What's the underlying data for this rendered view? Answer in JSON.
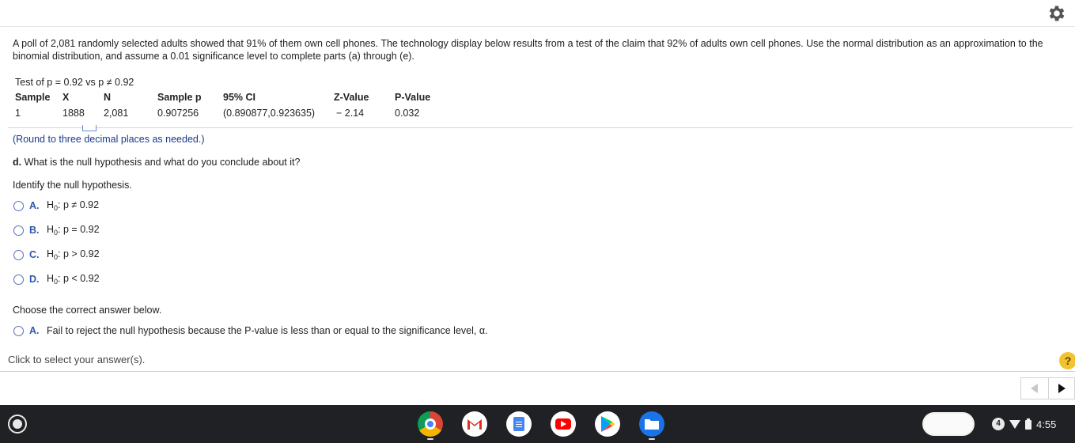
{
  "problem_text": "A poll of 2,081 randomly selected adults showed that 91% of them own cell phones. The technology display below results from a test of the claim that 92% of adults own cell phones. Use the normal distribution as an approximation to the binomial distribution, and assume a 0.01 significance level to complete parts (a) through (e).",
  "tech_display": {
    "test_line": "Test of p = 0.92 vs p ≠ 0.92",
    "headers": [
      "Sample",
      "X",
      "N",
      "Sample p",
      "95% CI",
      "Z-Value",
      "P-Value"
    ],
    "row": [
      "1",
      "1888",
      "2,081",
      "0.907256",
      "(0.890877,0.923635)",
      "− 2.14",
      "0.032"
    ]
  },
  "round_note": "(Round to three decimal places as needed.)",
  "part_d": {
    "label": "d.",
    "question": "What is the null hypothesis and what do you conclude about it?",
    "identify": "Identify the null hypothesis.",
    "options": [
      {
        "letter": "A.",
        "h": "H",
        "sub": "0",
        "text": ": p ≠ 0.92"
      },
      {
        "letter": "B.",
        "h": "H",
        "sub": "0",
        "text": ": p = 0.92"
      },
      {
        "letter": "C.",
        "h": "H",
        "sub": "0",
        "text": ": p > 0.92"
      },
      {
        "letter": "D.",
        "h": "H",
        "sub": "0",
        "text": ": p < 0.92"
      }
    ],
    "choose": "Choose the correct answer below.",
    "conclusion_options": [
      {
        "letter": "A.",
        "text": "Fail to reject the null hypothesis because the P-value is less than or equal to the significance level, α."
      }
    ]
  },
  "footer": {
    "click_select": "Click to select your answer(s).",
    "help": "?"
  },
  "taskbar": {
    "notification_count": "4",
    "time": "4:55"
  },
  "colors": {
    "link_blue": "#2f56b0",
    "help_yellow": "#f2c230",
    "shelf": "#202124"
  }
}
